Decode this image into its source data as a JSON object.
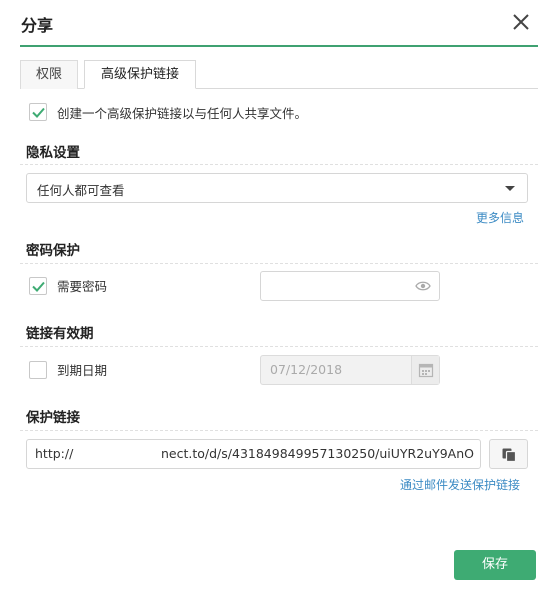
{
  "dialog": {
    "title": "分享",
    "close_icon": "close-icon"
  },
  "tabs": [
    {
      "label": "权限",
      "active": false
    },
    {
      "label": "高级保护链接",
      "active": true
    }
  ],
  "create_option": {
    "label": "创建一个高级保护链接以与任何人共享文件。",
    "checked": true
  },
  "privacy": {
    "title": "隐私设置",
    "selected": "任何人都可查看",
    "more_info": "更多信息"
  },
  "password": {
    "title": "密码保护",
    "require_label": "需要密码",
    "checked": true,
    "value": "",
    "eye_icon": "eye-icon"
  },
  "expiry": {
    "title": "链接有效期",
    "label": "到期日期",
    "checked": false,
    "date": "07/12/2018",
    "calendar_icon": "calendar-icon"
  },
  "protected_link": {
    "title": "保护链接",
    "url_prefix": "http://",
    "url_visible": "nect.to/d/s/431849849957130250/uiUYR2uY9AnO",
    "copy_icon": "copy-icon",
    "email_link": "通过邮件发送保护链接"
  },
  "actions": {
    "save_label": "保存"
  },
  "colors": {
    "accent": "#3eab73",
    "link": "#3c8bc4"
  }
}
